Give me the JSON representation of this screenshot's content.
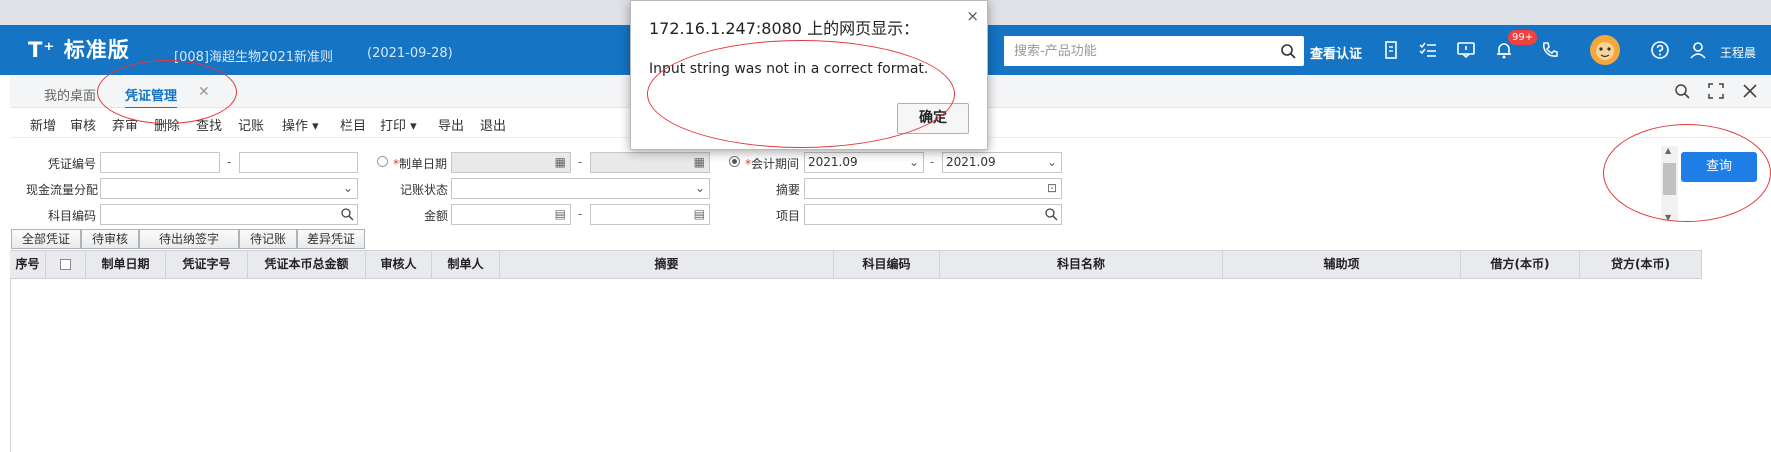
{
  "app": {
    "logo_text": "T⁺ 标准版",
    "company": "[008]海超生物2021新准则",
    "company_date": "(2021-09-28)",
    "search_placeholder": "搜索-产品功能",
    "verify_link": "查看认证",
    "badge_count": "99+",
    "user_name": "王程晨"
  },
  "tabs": {
    "home": "我的桌面",
    "active": "凭证管理",
    "close": "✕"
  },
  "menu": {
    "new": "新增",
    "audit": "审核",
    "discard": "弃审",
    "delete": "删除",
    "find": "查找",
    "post": "记账",
    "operate": "操作",
    "columns": "栏目",
    "print": "打印",
    "export": "导出",
    "exit": "退出"
  },
  "filter": {
    "voucher_no_label": "凭证编号",
    "cashflow_label": "现金流量分配",
    "account_code_label": "科目编码",
    "date_label": "制单日期",
    "posting_status_label": "记账状态",
    "amount_label": "金额",
    "period_label": "会计期间",
    "summary_label": "摘要",
    "project_label": "项目",
    "required_mark": "*",
    "dash": "-",
    "period_from": "2021.09",
    "period_to": "2021.09",
    "query_button": "查询"
  },
  "filter_buttons": [
    "全部凭证",
    "待审核",
    "待出纳签字",
    "待记账",
    "差异凭证"
  ],
  "table": {
    "columns": [
      "序号",
      "",
      "制单日期",
      "凭证字号",
      "凭证本币总金额",
      "审核人",
      "制单人",
      "摘要",
      "科目编码",
      "科目名称",
      "辅助项",
      "借方(本币)",
      "贷方(本币)"
    ]
  },
  "dialog": {
    "title": "172.16.1.247:8080 上的网页显示：",
    "message": "Input string was not in a correct format.",
    "ok": "确定",
    "close": "×"
  },
  "colors": {
    "topbar": "#1574c4",
    "accent": "#1e7ee6",
    "annotation": "#e0393c",
    "badge": "#f0413f"
  }
}
